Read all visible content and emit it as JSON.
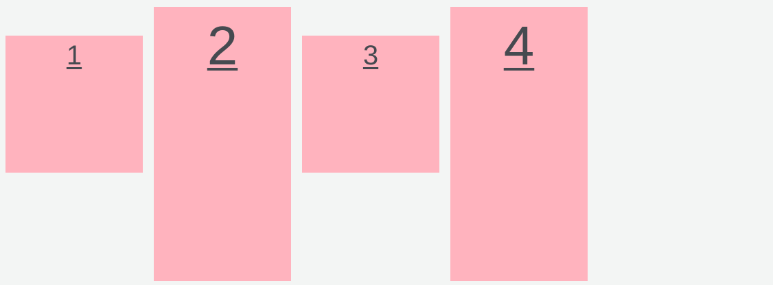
{
  "boxes": [
    {
      "label": "1"
    },
    {
      "label": "2"
    },
    {
      "label": "3"
    },
    {
      "label": "4"
    }
  ],
  "colors": {
    "background": "#f3f5f4",
    "box": "#ffb3be",
    "text": "#464a50"
  }
}
